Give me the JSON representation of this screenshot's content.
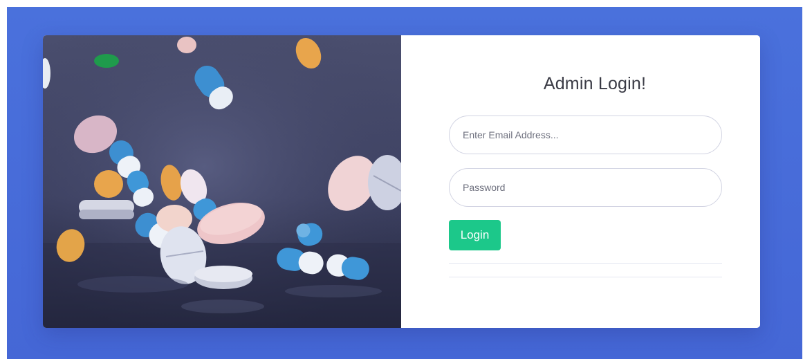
{
  "login": {
    "title": "Admin Login!",
    "email_placeholder": "Enter Email Address...",
    "password_placeholder": "Password",
    "login_label": "Login"
  },
  "colors": {
    "background_blue": "#4a71dc",
    "button_green": "#1cc88a",
    "title_text": "#3a3b45",
    "placeholder_text": "#6e707e",
    "input_border": "#d1d3e2"
  }
}
